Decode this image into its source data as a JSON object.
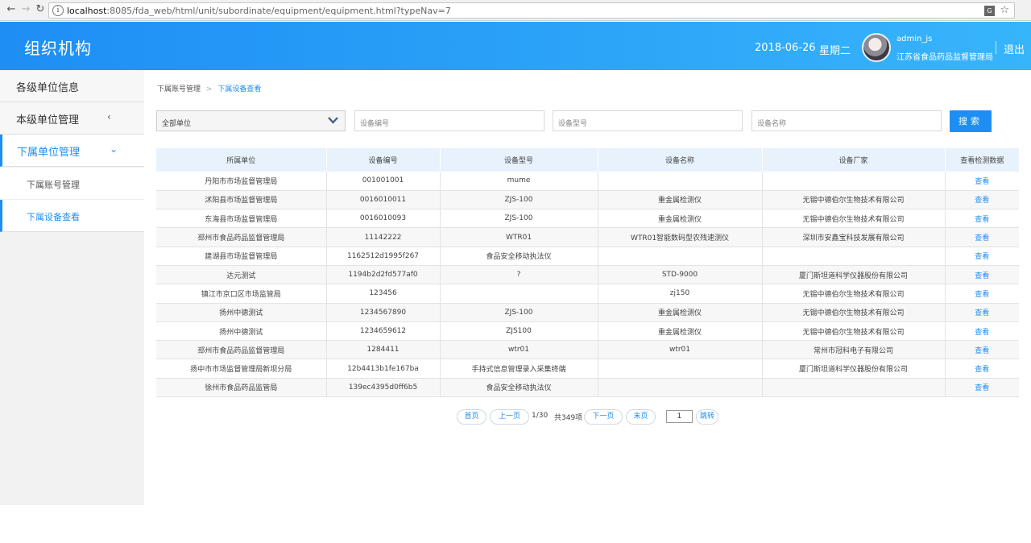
{
  "browser": {
    "url_host": "localhost",
    "url_rest": ":8085/fda_web/html/unit/subordinate/equipment/equipment.html?typeNav=7"
  },
  "header": {
    "title": "组织机构",
    "date": "2018-06-26",
    "weekday": "星期二",
    "user_name": "admin_js",
    "user_org": "江苏省食品药品监督管理局",
    "logout": "退出"
  },
  "sidebar": {
    "items": [
      {
        "label": "各级单位信息"
      },
      {
        "label": "本级单位管理",
        "chevron": "‹"
      },
      {
        "label": "下属单位管理",
        "chevron": "⌄"
      }
    ],
    "sub_items": [
      {
        "label": "下属账号管理"
      },
      {
        "label": "下属设备查看"
      }
    ]
  },
  "breadcrumb": {
    "parent": "下属账号管理",
    "separator": ">",
    "current": "下属设备查看"
  },
  "filters": {
    "unit_select": "全部单位",
    "code_placeholder": "设备编号",
    "model_placeholder": "设备型号",
    "name_placeholder": "设备名称",
    "search_label": "搜索"
  },
  "table": {
    "columns": [
      "所属单位",
      "设备编号",
      "设备型号",
      "设备名称",
      "设备厂家",
      "查看检测数据"
    ],
    "rows": [
      [
        "丹阳市市场监督管理局",
        "001001001",
        "mume",
        "",
        "",
        "查看"
      ],
      [
        "沭阳县市场监督管理局",
        "0016010011",
        "ZJS-100",
        "重金属检测仪",
        "无锡中德伯尔生物技术有限公司",
        "查看"
      ],
      [
        "东海县市场监督管理局",
        "0016010093",
        "ZJS-100",
        "重金属检测仪",
        "无锡中德伯尔生物技术有限公司",
        "查看"
      ],
      [
        "邳州市食品药品监督管理局",
        "11142222",
        "WTR01",
        "WTR01智能数码型农残速测仪",
        "深圳市安鑫宝科技发展有限公司",
        "查看"
      ],
      [
        "建湖县市场监督管理局",
        "1162512d1995f267",
        "食品安全移动执法仪",
        "",
        "",
        "查看"
      ],
      [
        "达元测试",
        "1194b2d2fd577af0",
        "?",
        "STD-9000",
        "厦门斯坦道科学仪器股份有限公司",
        "查看"
      ],
      [
        "镇江市京口区市场监管局",
        "123456",
        "",
        "zj150",
        "无锡中德伯尔生物技术有限公司",
        "查看"
      ],
      [
        "扬州中德测试",
        "1234567890",
        "ZJS-100",
        "重金属检测仪",
        "无锡中德伯尔生物技术有限公司",
        "查看"
      ],
      [
        "扬州中德测试",
        "1234659612",
        "ZJS100",
        "重金属检测仪",
        "无锡中德伯尔生物技术有限公司",
        "查看"
      ],
      [
        "邳州市食品药品监督管理局",
        "1284411",
        "wtr01",
        "wtr01",
        "常州市冠科电子有限公司",
        "查看"
      ],
      [
        "扬中市市场监督管理局新坝分局",
        "12b4413b1fe167ba",
        "手持式信息管理录入采集终端",
        "",
        "厦门斯坦道科学仪器股份有限公司",
        "查看"
      ],
      [
        "徐州市食品药品监管局",
        "139ec4395d0ff6b5",
        "食品安全移动执法仪",
        "",
        "",
        "查看"
      ]
    ]
  },
  "pager": {
    "first": "首页",
    "prev": "上一页",
    "page_info": "1/30",
    "total": "共349项",
    "next": "下一页",
    "last": "末页",
    "page_input": "1",
    "jump": "跳转"
  },
  "colors": {
    "accent": "#1e8ef5",
    "header_start": "#1e8ef5",
    "header_end": "#37b5fb"
  }
}
